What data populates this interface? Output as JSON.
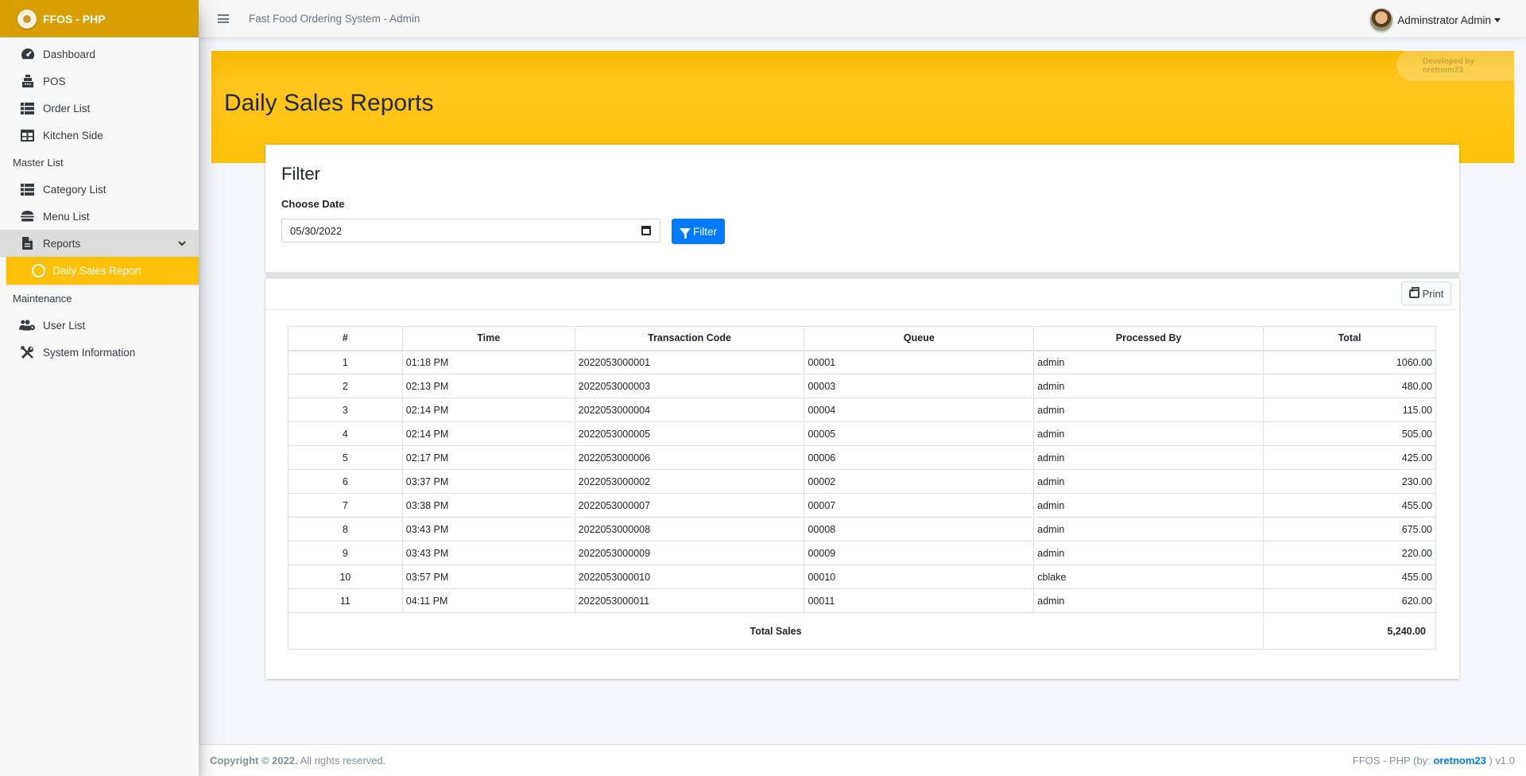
{
  "brand": {
    "name": "FFOS - PHP"
  },
  "sidebar": {
    "items": [
      {
        "label": "Dashboard",
        "icon": "dashboard-icon"
      },
      {
        "label": "POS",
        "icon": "cash-register-icon"
      },
      {
        "label": "Order List",
        "icon": "list-icon"
      },
      {
        "label": "Kitchen Side",
        "icon": "table-icon"
      }
    ],
    "master_header": "Master List",
    "master_items": [
      {
        "label": "Category List",
        "icon": "list-icon"
      },
      {
        "label": "Menu List",
        "icon": "hamburger-food-icon"
      },
      {
        "label": "Reports",
        "icon": "file-icon"
      }
    ],
    "sub_item": "Daily Sales Report",
    "maintenance_header": "Maintenance",
    "maintenance_items": [
      {
        "label": "User List",
        "icon": "users-cog-icon"
      },
      {
        "label": "System Information",
        "icon": "tools-icon"
      }
    ]
  },
  "topbar": {
    "system_title": "Fast Food Ordering System - Admin",
    "user_name": "Adminstrator Admin"
  },
  "banner": {
    "title": "Daily Sales Reports",
    "developed_by": "Developed by oretnom23"
  },
  "filter": {
    "title": "Filter",
    "label": "Choose Date",
    "date_value": "05/30/2022",
    "button_label": "Filter"
  },
  "report": {
    "print_label": "Print",
    "columns": [
      "#",
      "Time",
      "Transaction Code",
      "Queue",
      "Processed By",
      "Total"
    ],
    "rows": [
      [
        "1",
        "01:18 PM",
        "2022053000001",
        "00001",
        "admin",
        "1060.00"
      ],
      [
        "2",
        "02:13 PM",
        "2022053000003",
        "00003",
        "admin",
        "480.00"
      ],
      [
        "3",
        "02:14 PM",
        "2022053000004",
        "00004",
        "admin",
        "115.00"
      ],
      [
        "4",
        "02:14 PM",
        "2022053000005",
        "00005",
        "admin",
        "505.00"
      ],
      [
        "5",
        "02:17 PM",
        "2022053000006",
        "00006",
        "admin",
        "425.00"
      ],
      [
        "6",
        "03:37 PM",
        "2022053000002",
        "00002",
        "admin",
        "230.00"
      ],
      [
        "7",
        "03:38 PM",
        "2022053000007",
        "00007",
        "admin",
        "455.00"
      ],
      [
        "8",
        "03:43 PM",
        "2022053000008",
        "00008",
        "admin",
        "675.00"
      ],
      [
        "9",
        "03:43 PM",
        "2022053000009",
        "00009",
        "admin",
        "220.00"
      ],
      [
        "10",
        "03:57 PM",
        "2022053000010",
        "00010",
        "cblake",
        "455.00"
      ],
      [
        "11",
        "04:11 PM",
        "2022053000011",
        "00011",
        "admin",
        "620.00"
      ]
    ],
    "total_label": "Total Sales",
    "total_value": "5,240.00"
  },
  "footer": {
    "copyright": "Copyright © 2022.",
    "rights": " All rights reserved.",
    "app": "FFOS - PHP (by: ",
    "author": "oretnom23",
    "version": " ) v1.0"
  },
  "colors": {
    "brand": "#d79f00",
    "banner": "#ffc107",
    "primary": "#007bff"
  }
}
